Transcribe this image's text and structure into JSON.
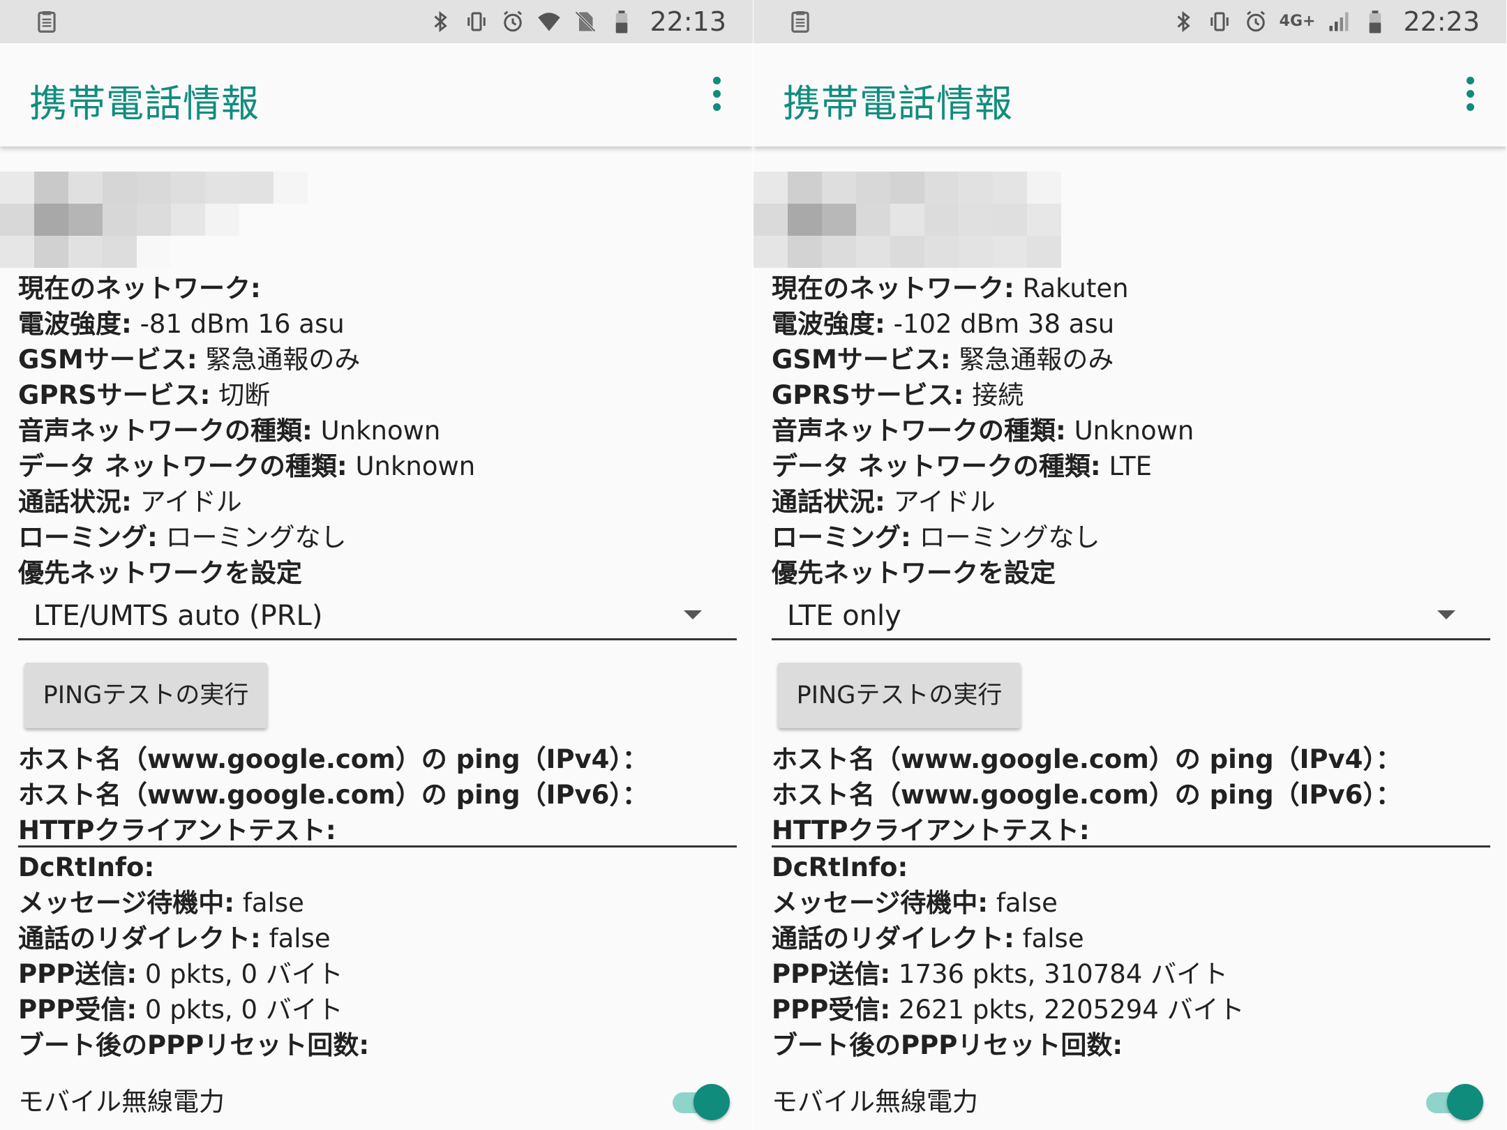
{
  "screens": [
    {
      "status": {
        "time": "22:13",
        "network_label": ""
      },
      "app_title": "携帯電話情報",
      "info": [
        {
          "label": "現在のネットワーク:",
          "value": ""
        },
        {
          "label": "電波強度:",
          "value": "-81 dBm   16 asu"
        },
        {
          "label": "GSMサービス:",
          "value": "緊急通報のみ"
        },
        {
          "label": "GPRSサービス:",
          "value": "切断"
        },
        {
          "label": "音声ネットワークの種類:",
          "value": "Unknown"
        },
        {
          "label": "データ ネットワークの種類:",
          "value": "Unknown"
        },
        {
          "label": "通話状況:",
          "value": "アイドル"
        },
        {
          "label": "ローミング:",
          "value": "ローミングなし"
        },
        {
          "label": "優先ネットワークを設定",
          "value": ""
        }
      ],
      "preferred_network": "LTE/UMTS auto (PRL)",
      "ping_button": "PINGテストの実行",
      "ping_lines": [
        {
          "label": "ホスト名（www.google.com）の ping（IPv4）：",
          "value": ""
        },
        {
          "label": "ホスト名（www.google.com）の ping（IPv6）：",
          "value": ""
        },
        {
          "label": "HTTPクライアントテスト:",
          "value": ""
        }
      ],
      "dcrt": [
        {
          "label": "DcRtInfo:",
          "value": ""
        },
        {
          "label": "メッセージ待機中:",
          "value": "false"
        },
        {
          "label": "通話のリダイレクト:",
          "value": "false"
        },
        {
          "label": "PPP送信:",
          "value": "0 pkts, 0 バイト"
        },
        {
          "label": "PPP受信:",
          "value": "0 pkts, 0 バイト"
        },
        {
          "label": "ブート後のPPPリセット回数:",
          "value": ""
        }
      ],
      "mobile_radio_label": "モバイル無線電力",
      "mobile_radio_on": true
    },
    {
      "status": {
        "time": "22:23",
        "network_label": "4G+"
      },
      "app_title": "携帯電話情報",
      "info": [
        {
          "label": "現在のネットワーク:",
          "value": "Rakuten"
        },
        {
          "label": "電波強度:",
          "value": "-102 dBm   38 asu"
        },
        {
          "label": "GSMサービス:",
          "value": "緊急通報のみ"
        },
        {
          "label": "GPRSサービス:",
          "value": "接続"
        },
        {
          "label": "音声ネットワークの種類:",
          "value": "Unknown"
        },
        {
          "label": "データ ネットワークの種類:",
          "value": "LTE"
        },
        {
          "label": "通話状況:",
          "value": "アイドル"
        },
        {
          "label": "ローミング:",
          "value": "ローミングなし"
        },
        {
          "label": "優先ネットワークを設定",
          "value": ""
        }
      ],
      "preferred_network": "LTE only",
      "ping_button": "PINGテストの実行",
      "ping_lines": [
        {
          "label": "ホスト名（www.google.com）の ping（IPv4）：",
          "value": ""
        },
        {
          "label": "ホスト名（www.google.com）の ping（IPv6）：",
          "value": ""
        },
        {
          "label": "HTTPクライアントテスト:",
          "value": ""
        }
      ],
      "dcrt": [
        {
          "label": "DcRtInfo:",
          "value": ""
        },
        {
          "label": "メッセージ待機中:",
          "value": "false"
        },
        {
          "label": "通話のリダイレクト:",
          "value": "false"
        },
        {
          "label": "PPP送信:",
          "value": "1736 pkts, 310784 バイト"
        },
        {
          "label": "PPP受信:",
          "value": "2621 pkts, 2205294 バイト"
        },
        {
          "label": "ブート後のPPPリセット回数:",
          "value": ""
        }
      ],
      "mobile_radio_label": "モバイル無線電力",
      "mobile_radio_on": true
    }
  ],
  "colors": {
    "accent": "#128c7e",
    "toggle_thumb": "#0f8c7c",
    "toggle_track": "#8fd4ca",
    "statusbar": "#e2e2e2",
    "button": "#dcdcdc"
  },
  "icons": {
    "statusbar_left": "clipboard-icon",
    "statusbar_right": [
      "bluetooth-icon",
      "vibrate-icon",
      "alarm-icon",
      "signal-icon",
      "battery-icon"
    ],
    "appbar_menu": "more-vert-icon",
    "dropdown": "chevron-down-icon"
  }
}
